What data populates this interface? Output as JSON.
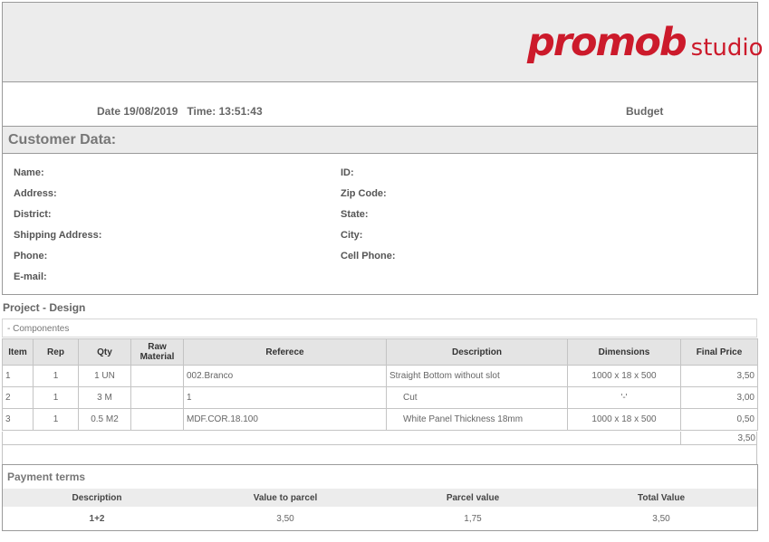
{
  "header": {
    "brand": "promob",
    "brand_sub": "studio"
  },
  "meta": {
    "date_label": "Date",
    "date_value": "19/08/2019",
    "time_label": "Time:",
    "time_value": "13:51:43",
    "doc_type": "Budget"
  },
  "customer": {
    "title": "Customer Data:",
    "fields_left": [
      "Name:",
      "Address:",
      "District:",
      "Shipping Address:",
      "Phone:",
      "E-mail:"
    ],
    "fields_right": [
      "ID:",
      "Zip Code:",
      "State:",
      "City:",
      "Cell Phone:"
    ]
  },
  "project": {
    "title": "Project - Design",
    "section": "- Componentes",
    "columns": [
      "Item",
      "Rep",
      "Qty",
      "Raw Material",
      "Referece",
      "Description",
      "Dimensions",
      "Final Price"
    ],
    "rows": [
      {
        "item": "1",
        "rep": "1",
        "qty": "1 UN",
        "raw": "",
        "ref": "002.Branco",
        "desc": "Straight Bottom without slot",
        "dim": "1000 x 18 x 500",
        "price": "3,50"
      },
      {
        "item": "2",
        "rep": "1",
        "qty": "3 M",
        "raw": "",
        "ref": "1",
        "desc": "Cut",
        "dim": "'-'",
        "price": "3,00"
      },
      {
        "item": "3",
        "rep": "1",
        "qty": "0.5 M2",
        "raw": "",
        "ref": "MDF.COR.18.100",
        "desc": "White Panel Thickness 18mm",
        "dim": "1000 x 18 x 500",
        "price": "0,50"
      }
    ],
    "total": "3,50"
  },
  "payment": {
    "title": "Payment terms",
    "headers": [
      "Description",
      "Value to parcel",
      "Parcel value",
      "Total Value"
    ],
    "row": [
      "1+2",
      "3,50",
      "1,75",
      "3,50"
    ]
  }
}
